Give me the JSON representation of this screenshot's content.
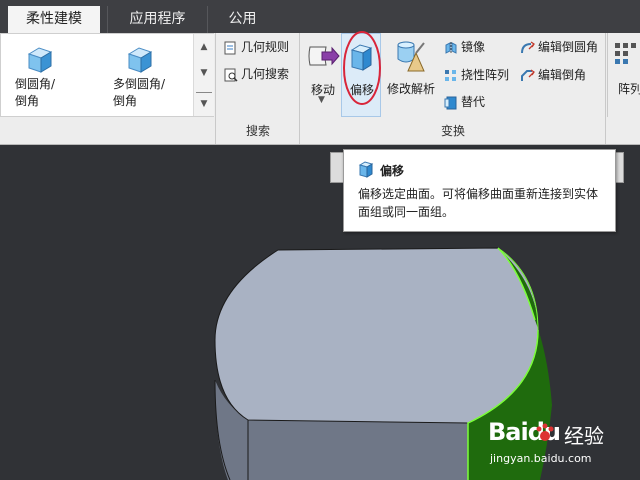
{
  "tabs": [
    {
      "label": "柔性建模",
      "active": true
    },
    {
      "label": "应用程序",
      "active": false
    },
    {
      "label": "公用",
      "active": false
    }
  ],
  "gallery": {
    "items": [
      {
        "label_line1": "倒圆角/",
        "label_line2": "倒角"
      },
      {
        "label_line1": "多倒圆角/",
        "label_line2": "倒角"
      }
    ]
  },
  "search_group": {
    "label": "搜索",
    "buttons": [
      {
        "label": "几何规则"
      },
      {
        "label": "几何搜索"
      }
    ]
  },
  "transform_group": {
    "label": "变换",
    "move_label": "移动",
    "offset_label": "偏移",
    "modify_label": "修改解析",
    "mirror_label": "镜像",
    "pattern_label": "挠性阵列",
    "replace_label": "替代",
    "edit_round_label": "编辑倒圆角",
    "edit_chamfer_label": "编辑倒角"
  },
  "array_label": "阵列",
  "tooltip": {
    "title": "偏移",
    "body": "偏移选定曲面。可将偏移曲面重新连接到实体面组或同一面组。"
  },
  "watermark": {
    "brand": "Baidu",
    "suffix": "经验",
    "url": "jingyan.baidu.com"
  },
  "colors": {
    "highlight_circle": "#d9253a",
    "model_face": "#a9b2c3",
    "model_side": "#6f7787",
    "selected_face": "#1f6b0d",
    "selected_edge": "#7cff3a"
  }
}
